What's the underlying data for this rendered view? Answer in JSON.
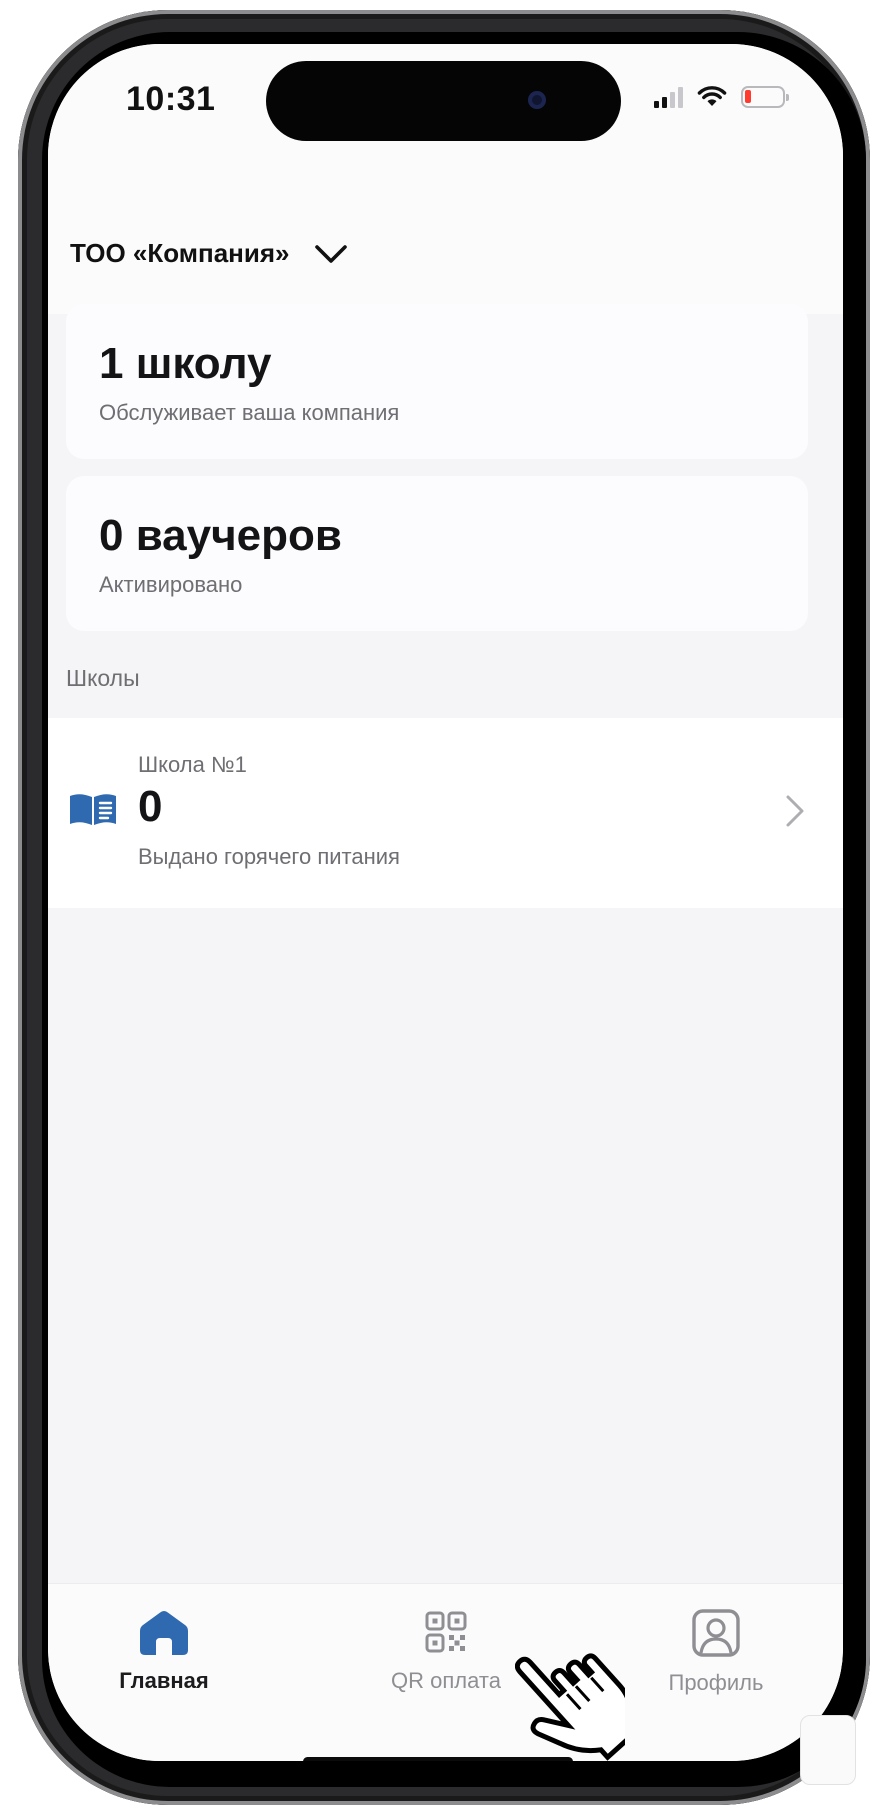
{
  "status_bar": {
    "time": "10:31"
  },
  "header": {
    "company_name": "ТОО «Компания»"
  },
  "stats": [
    {
      "value": "1 школу",
      "caption": "Обслуживает ваша компания"
    },
    {
      "value": "0 ваучеров",
      "caption": "Активировано"
    }
  ],
  "schools_section": {
    "label": "Школы",
    "items": [
      {
        "name": "Школа №1",
        "count": "0",
        "caption": "Выдано горячего питания"
      }
    ]
  },
  "tab_bar": {
    "tabs": [
      {
        "label": "Главная",
        "icon": "home-icon",
        "active": true
      },
      {
        "label": "QR оплата",
        "icon": "qr-code-icon",
        "active": false
      },
      {
        "label": "Профиль",
        "icon": "profile-icon",
        "active": false
      }
    ]
  },
  "colors": {
    "accent": "#2f6ab0",
    "background": "#f5f5f7",
    "card": "#fcfbfd",
    "muted_text": "#6e6e73",
    "battery_low": "#ff3b30"
  }
}
